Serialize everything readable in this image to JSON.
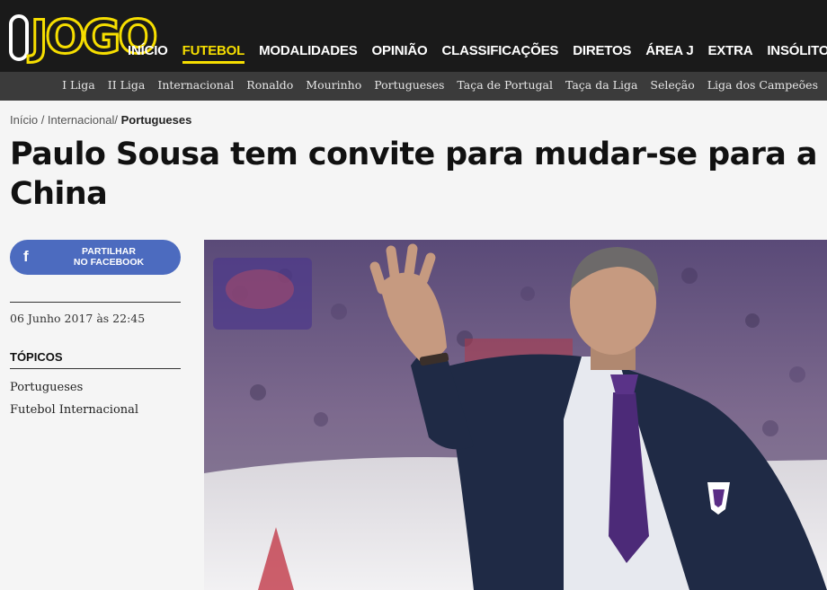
{
  "logo": {
    "text": "O JOGO"
  },
  "main_nav": [
    "INÍCIO",
    "FUTEBOL",
    "MODALIDADES",
    "OPINIÃO",
    "CLASSIFICAÇÕES",
    "DIRETOS",
    "ÁREA J",
    "EXTRA",
    "INSÓLITO"
  ],
  "main_nav_active": "FUTEBOL",
  "sub_nav": [
    "I Liga",
    "II Liga",
    "Internacional",
    "Ronaldo",
    "Mourinho",
    "Portugueses",
    "Taça de Portugal",
    "Taça da Liga",
    "Seleção",
    "Liga dos Campeões"
  ],
  "breadcrumb": {
    "item1": "Início",
    "sep1": " / ",
    "item2": "Internacional",
    "sep2": "/ ",
    "item3": "Portugueses"
  },
  "headline": "Paulo Sousa tem convite para mudar-se para a China",
  "share": {
    "icon_letter": "f",
    "line1": "PARTILHAR",
    "line2": "NO FACEBOOK"
  },
  "date": "06 Junho 2017 às 22:45",
  "topics": {
    "heading": "TÓPICOS",
    "items": [
      "Portugueses",
      "Futebol Internacional"
    ]
  },
  "colors": {
    "accent": "#f6de00",
    "topbar": "#1a1a1a",
    "subbar": "#3b3b3b",
    "facebook": "#4c6bbf"
  }
}
